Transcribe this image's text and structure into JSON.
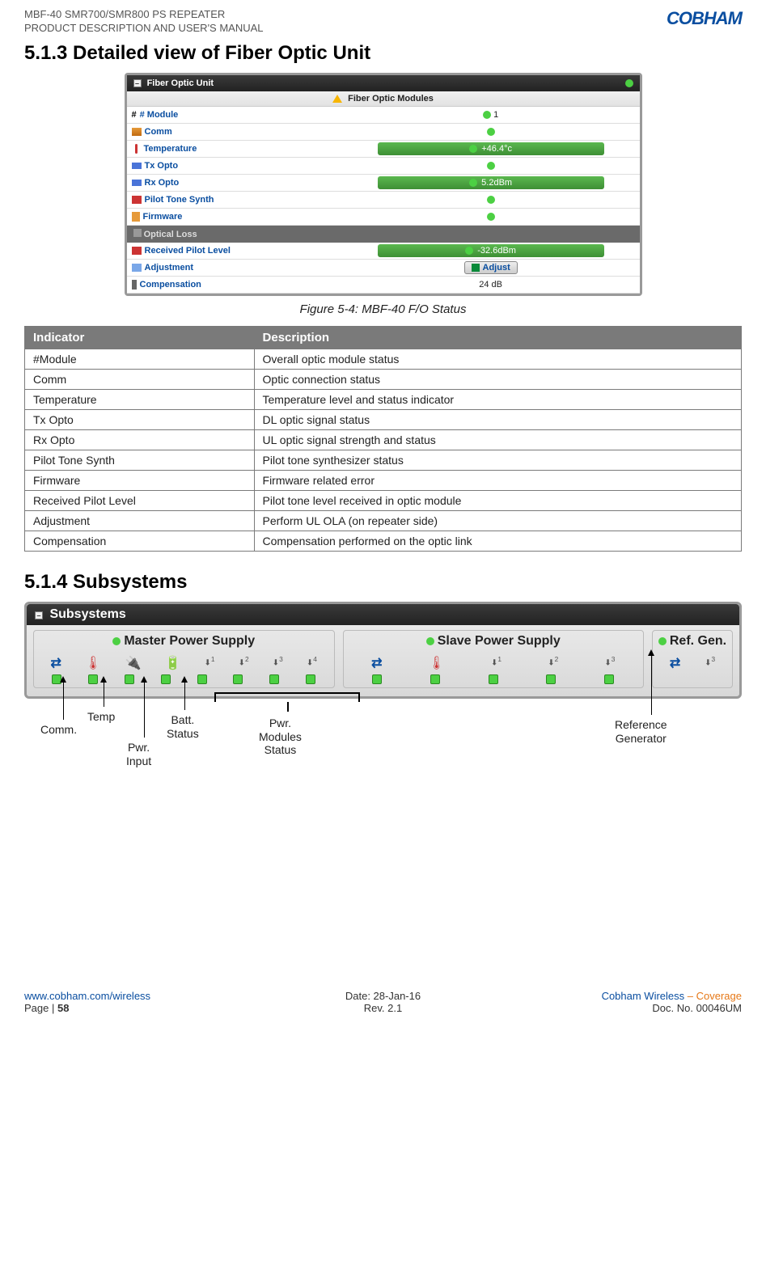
{
  "header": {
    "line1": "MBF-40 SMR700/SMR800 PS REPEATER",
    "line2": "PRODUCT DESCRIPTION AND USER'S MANUAL",
    "brand": "COBHAM"
  },
  "section_513": {
    "number_title": "5.1.3 Detailed view of Fiber Optic Unit",
    "panel_title": "Fiber Optic Unit",
    "modules_header": "Fiber Optic Modules",
    "rows": {
      "module_label": "# Module",
      "module_val": "1",
      "comm_label": "Comm",
      "temp_label": "Temperature",
      "temp_val": "+46.4°c",
      "tx_label": "Tx Opto",
      "rx_label": "Rx Opto",
      "rx_val": "5.2dBm",
      "pilot_label": "Pilot Tone Synth",
      "firmware_label": "Firmware",
      "optical_loss_label": "Optical Loss",
      "received_pilot_label": "Received Pilot Level",
      "received_pilot_val": "-32.6dBm",
      "adjust_label": "Adjustment",
      "adjust_btn": "Adjust",
      "comp_label": "Compensation",
      "comp_val": "24 dB"
    },
    "caption": "Figure 5-4: MBF-40 F/O Status"
  },
  "desc_table": {
    "header_indicator": "Indicator",
    "header_description": "Description",
    "rows": [
      {
        "ind": "#Module",
        "desc": "Overall optic module status"
      },
      {
        "ind": "Comm",
        "desc": "Optic connection status"
      },
      {
        "ind": "Temperature",
        "desc": "Temperature level and status indicator"
      },
      {
        "ind": "Tx Opto",
        "desc": "DL optic signal status"
      },
      {
        "ind": "Rx Opto",
        "desc": "UL optic signal strength and status"
      },
      {
        "ind": "Pilot Tone Synth",
        "desc": "Pilot tone synthesizer status"
      },
      {
        "ind": "Firmware",
        "desc": "Firmware related error"
      },
      {
        "ind": "Received Pilot Level",
        "desc": "Pilot tone level received in optic module"
      },
      {
        "ind": "Adjustment",
        "desc": "Perform UL OLA (on repeater side)"
      },
      {
        "ind": "Compensation",
        "desc": "Compensation performed on the optic link"
      }
    ]
  },
  "section_514": {
    "number_title": "5.1.4 Subsystems",
    "panel_title": "Subsystems",
    "col_master": "Master Power Supply",
    "col_slave": "Slave Power Supply",
    "col_ref": "Ref. Gen.",
    "icon_labels_master": [
      "",
      "",
      "",
      "",
      "1",
      "2",
      "3",
      "4"
    ],
    "icon_labels_slave": [
      "",
      "",
      "1",
      "2",
      "3"
    ],
    "icon_labels_ref": [
      "",
      "",
      "3"
    ]
  },
  "annotations": {
    "comm": "Comm.",
    "temp": "Temp",
    "pwr_input": "Pwr. Input",
    "batt": "Batt. Status",
    "pwr_modules": "Pwr. Modules Status",
    "ref_gen": "Reference Generator"
  },
  "footer": {
    "url": "www.cobham.com/wireless",
    "page": "Page | 58",
    "date": "Date: 28-Jan-16",
    "rev": "Rev. 2.1",
    "company": "Cobham Wireless",
    "coverage": " – Coverage",
    "doc": "Doc. No. 00046UM"
  }
}
